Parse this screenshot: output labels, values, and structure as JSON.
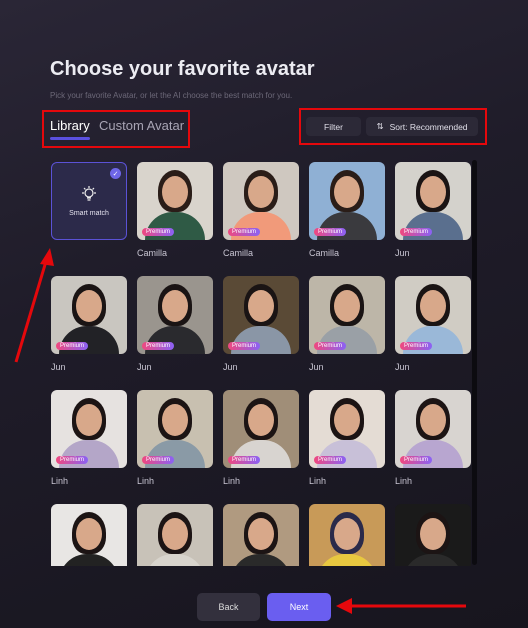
{
  "header": {
    "title": "Choose your favorite avatar",
    "subtitle": "Pick your favorite Avatar, or let the AI choose the best match for you."
  },
  "tabs": [
    {
      "label": "Library",
      "active": true
    },
    {
      "label": "Custom Avatar",
      "active": false
    }
  ],
  "toolbar": {
    "filter_label": "Filter",
    "sort_label": "Sort: Recommended",
    "sort_icon": "sort-arrows-icon"
  },
  "smart_match": {
    "label": "Smart match",
    "icon": "lightbulb-icon",
    "selected": true
  },
  "badge_label": "Premium",
  "avatars": [
    {
      "name": "Camilla",
      "premium": true,
      "shirt": "#2f5a45",
      "bg": "#d9d4cc",
      "hair": "#2a1d18"
    },
    {
      "name": "Camilla",
      "premium": true,
      "shirt": "#f19a7a",
      "bg": "#cfc8c0",
      "hair": "#2a1d18"
    },
    {
      "name": "Camilla",
      "premium": true,
      "shirt": "#3a3a3e",
      "bg": "#8fb0d4",
      "hair": "#2a1d18"
    },
    {
      "name": "Jun",
      "premium": true,
      "shirt": "#5a6f8e",
      "bg": "#d4d2cc",
      "hair": "#1a1414"
    },
    {
      "name": "Jun",
      "premium": true,
      "shirt": "#222226",
      "bg": "#c9c6c0",
      "hair": "#1a1414"
    },
    {
      "name": "Jun",
      "premium": true,
      "shirt": "#2a2a2e",
      "bg": "#9a958e",
      "hair": "#1a1414"
    },
    {
      "name": "Jun",
      "premium": true,
      "shirt": "#8a96a6",
      "bg": "#5a4a36",
      "hair": "#1a1414"
    },
    {
      "name": "Jun",
      "premium": true,
      "shirt": "#9aa0a6",
      "bg": "#bdb6a8",
      "hair": "#1a1414"
    },
    {
      "name": "Jun",
      "premium": true,
      "shirt": "#9ab8d8",
      "bg": "#d0ccc4",
      "hair": "#1a1414"
    },
    {
      "name": "Linh",
      "premium": true,
      "shirt": "#b4a6c8",
      "bg": "#e6e2e0",
      "hair": "#1c1414"
    },
    {
      "name": "Linh",
      "premium": true,
      "shirt": "#8a9aa6",
      "bg": "#c8c0b0",
      "hair": "#1c1414"
    },
    {
      "name": "Linh",
      "premium": true,
      "shirt": "#d8d4d0",
      "bg": "#a08e78",
      "hair": "#1c1414"
    },
    {
      "name": "Linh",
      "premium": true,
      "shirt": "#c8c0d8",
      "bg": "#e4dcd4",
      "hair": "#1c1414"
    },
    {
      "name": "Linh",
      "premium": true,
      "shirt": "#b8a6d0",
      "bg": "#d8d4d0",
      "hair": "#1c1414"
    },
    {
      "name": "",
      "premium": false,
      "shirt": "#222",
      "bg": "#e8e6e4",
      "hair": "#1c1414"
    },
    {
      "name": "",
      "premium": false,
      "shirt": "#d8d4cc",
      "bg": "#c8c2b8",
      "hair": "#1c1414"
    },
    {
      "name": "",
      "premium": false,
      "shirt": "#2a2a2a",
      "bg": "#b09a80",
      "hair": "#1c1414"
    },
    {
      "name": "",
      "premium": false,
      "shirt": "#e8c840",
      "bg": "#c89a58",
      "hair": "#2a2a4a"
    },
    {
      "name": "",
      "premium": false,
      "shirt": "#2a2a2a",
      "bg": "#1a1a1a",
      "hair": "#1c1414"
    }
  ],
  "footer": {
    "back_label": "Back",
    "next_label": "Next"
  },
  "annotation_color": "#e5080c"
}
